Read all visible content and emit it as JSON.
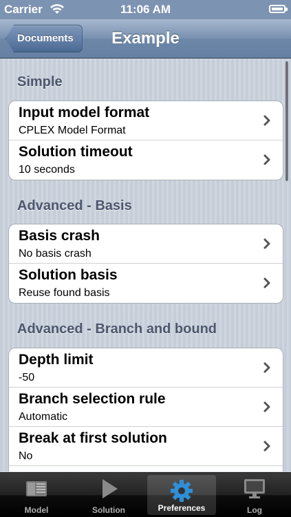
{
  "status_bar": {
    "carrier": "Carrier",
    "time": "11:06 AM"
  },
  "nav": {
    "back_label": "Documents",
    "title": "Example"
  },
  "sections": [
    {
      "header": "Simple",
      "rows": [
        {
          "title": "Input model format",
          "value": "CPLEX Model Format"
        },
        {
          "title": "Solution timeout",
          "value": "10 seconds"
        }
      ]
    },
    {
      "header": "Advanced - Basis",
      "rows": [
        {
          "title": "Basis crash",
          "value": "No basis crash"
        },
        {
          "title": "Solution basis",
          "value": "Reuse found basis"
        }
      ]
    },
    {
      "header": "Advanced - Branch and bound",
      "rows": [
        {
          "title": "Depth limit",
          "value": "-50"
        },
        {
          "title": "Branch selection rule",
          "value": "Automatic"
        },
        {
          "title": "Break at first solution",
          "value": "No"
        }
      ]
    }
  ],
  "tabs": [
    {
      "label": "Model",
      "icon": "model-icon"
    },
    {
      "label": "Solution",
      "icon": "play-icon"
    },
    {
      "label": "Preferences",
      "icon": "gear-icon",
      "selected": true
    },
    {
      "label": "Log",
      "icon": "monitor-icon"
    }
  ],
  "colors": {
    "nav_bar": "#6d87a9",
    "section_text": "#4c566c",
    "selected_tab_icon": "#2f8fd8"
  }
}
